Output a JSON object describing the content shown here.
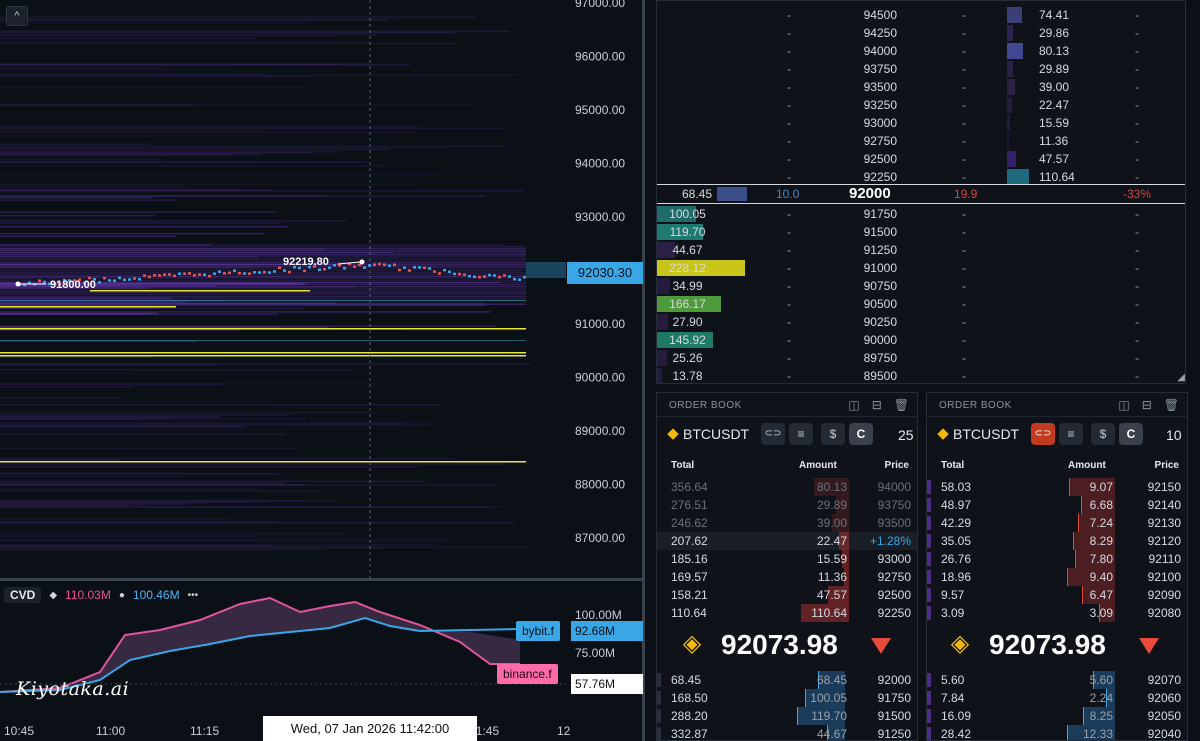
{
  "chart": {
    "price_axis": [
      "97000.00",
      "96000.00",
      "95000.00",
      "94000.00",
      "93000.00",
      "92030.30",
      "91000.00",
      "90000.00",
      "89000.00",
      "88000.00",
      "87000.00"
    ],
    "current_price": "92030.30",
    "annotations": {
      "low": "91800.00",
      "high": "92219.80"
    },
    "collapse_icon": "chevron-up-icon",
    "cvd": {
      "title": "CVD",
      "value1": "110.03M",
      "value2": "100.46M",
      "more": "•••",
      "axis": [
        "100.00M",
        "75.00M"
      ],
      "series": [
        {
          "name": "bybit.f",
          "value": "92.68M",
          "color": "#39a6e6"
        },
        {
          "name": "binance.f",
          "value": "57.76M",
          "color": "#ff5aa6"
        }
      ]
    },
    "time_axis": [
      "10:45",
      "11:00",
      "11:15",
      "11:30",
      "11:45",
      "12"
    ],
    "crosshair_time": "Wed, 07 Jan 2026 11:42:00",
    "logo": "Kiyotaka.ai"
  },
  "ladder": {
    "asks": [
      {
        "price": "94500",
        "ask": "74.41",
        "fill": 0.33,
        "color": "#3a3f78"
      },
      {
        "price": "94250",
        "ask": "29.86",
        "fill": 0.13,
        "color": "#2d2550"
      },
      {
        "price": "94000",
        "ask": "80.13",
        "fill": 0.36,
        "color": "#3f4890"
      },
      {
        "price": "93750",
        "ask": "29.89",
        "fill": 0.13,
        "color": "#2a2145"
      },
      {
        "price": "93500",
        "ask": "39.00",
        "fill": 0.17,
        "color": "#2a2145"
      },
      {
        "price": "93250",
        "ask": "22.47",
        "fill": 0.1,
        "color": "#241c3c"
      },
      {
        "price": "93000",
        "ask": "15.59",
        "fill": 0.07,
        "color": "#241c3c"
      },
      {
        "price": "92750",
        "ask": "11.36",
        "fill": 0.05,
        "color": "#201934"
      },
      {
        "price": "92500",
        "ask": "47.57",
        "fill": 0.21,
        "color": "#34206b"
      },
      {
        "price": "92250",
        "ask": "110.64",
        "fill": 0.49,
        "color": "#1f6a7c"
      }
    ],
    "mid": {
      "bid": "68.45",
      "left": "10.0",
      "price": "92000",
      "right": "19.9",
      "pct": "-33%"
    },
    "bids": [
      {
        "price": "91750",
        "bid": "100.05",
        "fill": 0.44,
        "color": "#1e6b67"
      },
      {
        "price": "91500",
        "bid": "119.70",
        "fill": 0.52,
        "color": "#1f7a6e"
      },
      {
        "price": "91250",
        "bid": "44.67",
        "fill": 0.2,
        "color": "#2a2145"
      },
      {
        "price": "91000",
        "bid": "228.12",
        "fill": 1.0,
        "color": "#c7c51a"
      },
      {
        "price": "90750",
        "bid": "34.99",
        "fill": 0.15,
        "color": "#241c3c"
      },
      {
        "price": "90500",
        "bid": "166.17",
        "fill": 0.73,
        "color": "#4f9a3a"
      },
      {
        "price": "90250",
        "bid": "27.90",
        "fill": 0.12,
        "color": "#241c3c"
      },
      {
        "price": "90000",
        "bid": "145.92",
        "fill": 0.64,
        "color": "#1e7a64"
      },
      {
        "price": "89750",
        "bid": "25.26",
        "fill": 0.11,
        "color": "#241c3c"
      },
      {
        "price": "89500",
        "bid": "13.78",
        "fill": 0.06,
        "color": "#241c3c"
      }
    ],
    "dash": "-",
    "corner": "◢"
  },
  "orderbooks": [
    {
      "title": "ORDER BOOK",
      "symbol": "BTCUSDT",
      "btn_c": "C",
      "btn_dollar": "$",
      "group": "25",
      "cols": {
        "total": "Total",
        "amount": "Amount",
        "price": "Price"
      },
      "asks": [
        {
          "total": "356.64",
          "amount": "80.13",
          "price": "94000",
          "fill": 0.72,
          "dim": true
        },
        {
          "total": "276.51",
          "amount": "29.89",
          "price": "93750",
          "fill": 0.27,
          "dim": true
        },
        {
          "total": "246.62",
          "amount": "39.00",
          "price": "93500",
          "fill": 0.35,
          "dim": true
        },
        {
          "total": "207.62",
          "amount": "22.47",
          "price": "+1.28%",
          "fill": 0.2,
          "dim": false,
          "pct": true
        },
        {
          "total": "185.16",
          "amount": "15.59",
          "price": "93000",
          "fill": 0.14,
          "dim": false
        },
        {
          "total": "169.57",
          "amount": "11.36",
          "price": "92750",
          "fill": 0.1,
          "dim": false
        },
        {
          "total": "158.21",
          "amount": "47.57",
          "price": "92500",
          "fill": 0.43,
          "dim": false
        },
        {
          "total": "110.64",
          "amount": "110.64",
          "price": "92250",
          "fill": 1.0,
          "dim": false
        }
      ],
      "last_price": "92073.98",
      "bids": [
        {
          "total": "68.45",
          "amount": "68.45",
          "price": "92000",
          "fill": 0.57
        },
        {
          "total": "168.50",
          "amount": "100.05",
          "price": "91750",
          "fill": 0.84
        },
        {
          "total": "288.20",
          "amount": "119.70",
          "price": "91500",
          "fill": 1.0
        },
        {
          "total": "332.87",
          "amount": "44.67",
          "price": "91250",
          "fill": 0.37
        }
      ]
    },
    {
      "title": "ORDER BOOK",
      "symbol": "BTCUSDT",
      "btn_c": "C",
      "btn_dollar": "$",
      "group": "10",
      "cols": {
        "total": "Total",
        "amount": "Amount",
        "price": "Price"
      },
      "asks": [
        {
          "total": "58.03",
          "amount": "9.07",
          "price": "92150",
          "fill": 0.96
        },
        {
          "total": "48.97",
          "amount": "6.68",
          "price": "92140",
          "fill": 0.71
        },
        {
          "total": "42.29",
          "amount": "7.24",
          "price": "92130",
          "fill": 0.77
        },
        {
          "total": "35.05",
          "amount": "8.29",
          "price": "92120",
          "fill": 0.88
        },
        {
          "total": "26.76",
          "amount": "7.80",
          "price": "92110",
          "fill": 0.83
        },
        {
          "total": "18.96",
          "amount": "9.40",
          "price": "92100",
          "fill": 1.0
        },
        {
          "total": "9.57",
          "amount": "6.47",
          "price": "92090",
          "fill": 0.69
        },
        {
          "total": "3.09",
          "amount": "3.09",
          "price": "92080",
          "fill": 0.33
        }
      ],
      "last_price": "92073.98",
      "bids": [
        {
          "total": "5.60",
          "amount": "5.60",
          "price": "92070",
          "fill": 0.45
        },
        {
          "total": "7.84",
          "amount": "2.24",
          "price": "92060",
          "fill": 0.18
        },
        {
          "total": "16.09",
          "amount": "8.25",
          "price": "92050",
          "fill": 0.67
        },
        {
          "total": "28.42",
          "amount": "12.33",
          "price": "92040",
          "fill": 1.0
        }
      ]
    }
  ]
}
